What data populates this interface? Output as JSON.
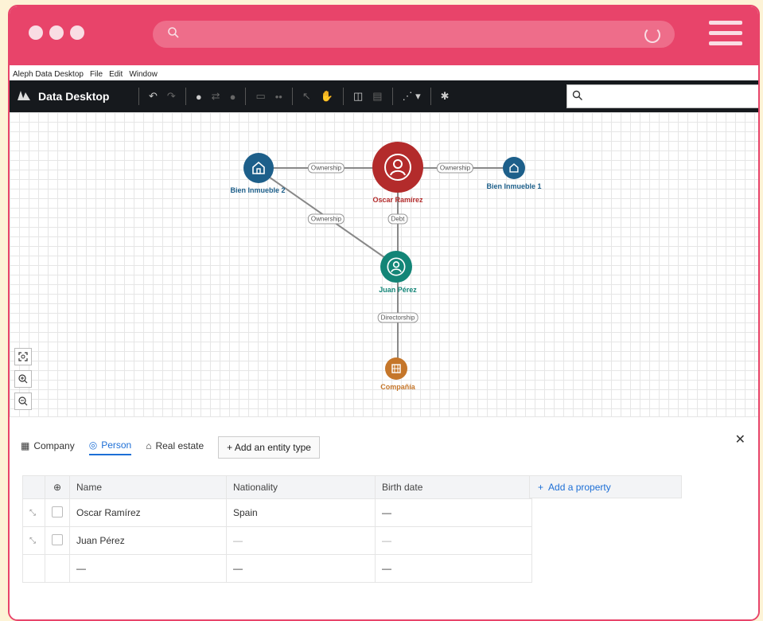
{
  "menubar": {
    "app_name": "Aleph Data Desktop",
    "file": "File",
    "edit": "Edit",
    "window": "Window"
  },
  "toolbar": {
    "title": "Data Desktop"
  },
  "graph": {
    "nodes": [
      {
        "label": "Bien Inmueble 2",
        "color": "#1d5f8a",
        "type": "real-estate"
      },
      {
        "label": "Oscar Ramírez",
        "color": "#b32b2b",
        "type": "person"
      },
      {
        "label": "Bien Inmueble 1",
        "color": "#1d5f8a",
        "type": "real-estate"
      },
      {
        "label": "Juan Pérez",
        "color": "#138577",
        "type": "person"
      },
      {
        "label": "Compañía",
        "color": "#c5762a",
        "type": "company"
      }
    ],
    "edges": [
      {
        "label": "Ownership"
      },
      {
        "label": "Ownership"
      },
      {
        "label": "Ownership"
      },
      {
        "label": "Debt"
      },
      {
        "label": "Directorship"
      }
    ]
  },
  "panel": {
    "tabs": [
      {
        "label": "Company",
        "icon": "company-icon"
      },
      {
        "label": "Person",
        "icon": "person-icon"
      },
      {
        "label": "Real estate",
        "icon": "home-icon"
      }
    ],
    "add_entity_type": "Add an entity type",
    "add_property": "Add a property",
    "columns": [
      "Name",
      "Nationality",
      "Birth date"
    ],
    "rows": [
      [
        "Oscar Ramírez",
        "Spain",
        "—"
      ],
      [
        "Juan Pérez",
        "—",
        "—"
      ],
      [
        "—",
        "—",
        "—"
      ]
    ]
  }
}
